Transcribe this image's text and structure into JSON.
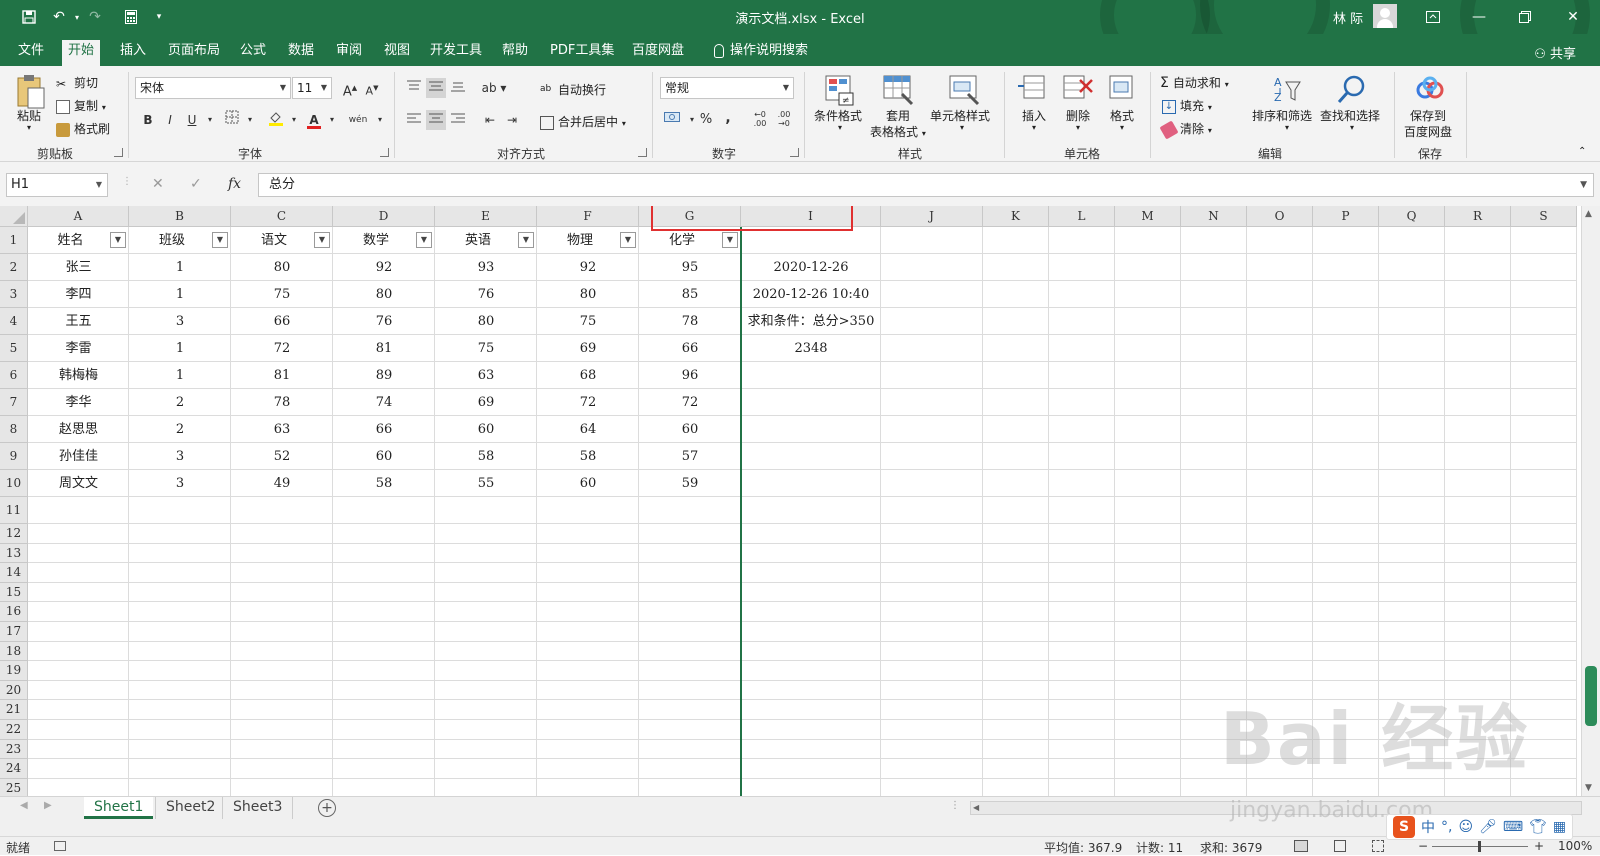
{
  "titlebar": {
    "title": "演示文档.xlsx - Excel",
    "user": "林 际",
    "save_icon": "save-icon",
    "undo_icon": "undo-icon",
    "redo_icon": "redo-icon",
    "calc_icon": "calculator-icon",
    "qat_more": "▾"
  },
  "tabs": [
    "文件",
    "开始",
    "插入",
    "页面布局",
    "公式",
    "数据",
    "审阅",
    "视图",
    "开发工具",
    "帮助",
    "PDF工具集",
    "百度网盘"
  ],
  "active_tab": "开始",
  "tell_me": "操作说明搜索",
  "share": "共享",
  "ribbon": {
    "clipboard": {
      "paste": "粘贴",
      "cut": "剪切",
      "copy": "复制",
      "format_painter": "格式刷",
      "label": "剪贴板"
    },
    "font": {
      "name": "宋体",
      "size": "11",
      "bold": "B",
      "italic": "I",
      "underline": "U",
      "grow": "A",
      "shrink": "A",
      "phonetic": "wén",
      "label": "字体"
    },
    "alignment": {
      "wrap": "自动换行",
      "merge": "合并后居中",
      "label": "对齐方式"
    },
    "number": {
      "format": "常规",
      "percent": "%",
      "comma": ",",
      "label": "数字"
    },
    "styles": {
      "conditional": "条件格式",
      "table_format_1": "套用",
      "table_format_2": "表格格式",
      "cell_styles": "单元格样式",
      "label": "样式"
    },
    "cells": {
      "insert": "插入",
      "delete": "删除",
      "format": "格式",
      "label": "单元格"
    },
    "editing": {
      "autosum": "自动求和",
      "fill": "填充",
      "clear": "清除",
      "sort": "排序和筛选",
      "find": "查找和选择",
      "label": "编辑"
    },
    "save": {
      "save_1": "保存到",
      "save_2": "百度网盘",
      "label": "保存"
    }
  },
  "formula_bar": {
    "name_box": "H1",
    "cancel": "✕",
    "enter": "✓",
    "fx": "fx",
    "content": "总分"
  },
  "columns": [
    "A",
    "B",
    "C",
    "D",
    "E",
    "F",
    "G",
    "I",
    "J",
    "K",
    "L",
    "M",
    "N",
    "O",
    "P",
    "Q",
    "R",
    "S"
  ],
  "rows": [
    "1",
    "2",
    "3",
    "4",
    "5",
    "6",
    "7",
    "8",
    "9",
    "10",
    "11",
    "12",
    "13",
    "14",
    "15",
    "16",
    "17",
    "18",
    "19",
    "20",
    "21",
    "22",
    "23",
    "24",
    "25"
  ],
  "headers": [
    "姓名",
    "班级",
    "语文",
    "数学",
    "英语",
    "物理",
    "化学"
  ],
  "data": [
    [
      "张三",
      "1",
      "80",
      "92",
      "93",
      "92",
      "95"
    ],
    [
      "李四",
      "1",
      "75",
      "80",
      "76",
      "80",
      "85"
    ],
    [
      "王五",
      "3",
      "66",
      "76",
      "80",
      "75",
      "78"
    ],
    [
      "李雷",
      "1",
      "72",
      "81",
      "75",
      "69",
      "66"
    ],
    [
      "韩梅梅",
      "1",
      "81",
      "89",
      "63",
      "68",
      "96"
    ],
    [
      "李华",
      "2",
      "78",
      "74",
      "69",
      "72",
      "72"
    ],
    [
      "赵思思",
      "2",
      "63",
      "66",
      "60",
      "64",
      "60"
    ],
    [
      "孙佳佳",
      "3",
      "52",
      "60",
      "58",
      "58",
      "57"
    ],
    [
      "周文文",
      "3",
      "49",
      "58",
      "55",
      "60",
      "59"
    ]
  ],
  "col_i": [
    "2020-12-26",
    "2020-12-26 10:40",
    "求和条件：总分>350",
    "2348"
  ],
  "sheets": [
    "Sheet1",
    "Sheet2",
    "Sheet3"
  ],
  "active_sheet": "Sheet1",
  "status": {
    "ready": "就绪",
    "average": "平均值: 367.9",
    "count": "计数: 11",
    "sum": "求和: 3679",
    "zoom": "100%"
  },
  "watermark": {
    "main": "Bai 经验",
    "sub": "jingyan.baidu.com"
  },
  "ime": {
    "logo": "S",
    "lang": "中"
  }
}
